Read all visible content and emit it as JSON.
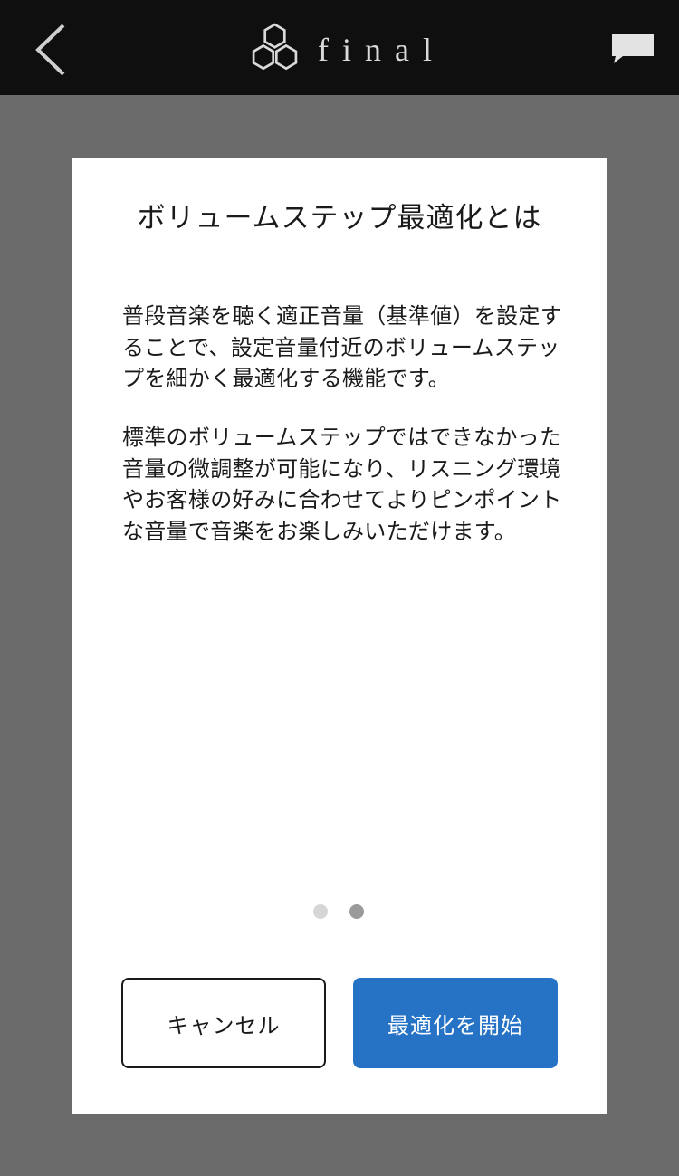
{
  "header": {
    "brand": "final",
    "back_icon": "chevron-left-icon",
    "chat_icon": "chat-bubble-icon"
  },
  "dialog": {
    "title": "ボリュームステップ最適化とは",
    "paragraph1": "普段音楽を聴く適正音量（基準値）を設定することで、設定音量付近のボリュームステップを細かく最適化する機能です。",
    "paragraph2": "標準のボリュームステップではできなかった音量の微調整が可能になり、リスニング環境やお客様の好みに合わせてよりピンポイントな音量で音楽をお楽しみいただけます。",
    "pagination": {
      "total": 2,
      "current": 2
    },
    "cancel_label": "キャンセル",
    "start_label": "最適化を開始"
  },
  "colors": {
    "header_bg": "#0f0f0f",
    "overlay_bg": "#6b6b6b",
    "dialog_bg": "#ffffff",
    "primary_button": "#2673c5",
    "dot_inactive": "#d6d6d6",
    "dot_active": "#9a9a9a"
  }
}
